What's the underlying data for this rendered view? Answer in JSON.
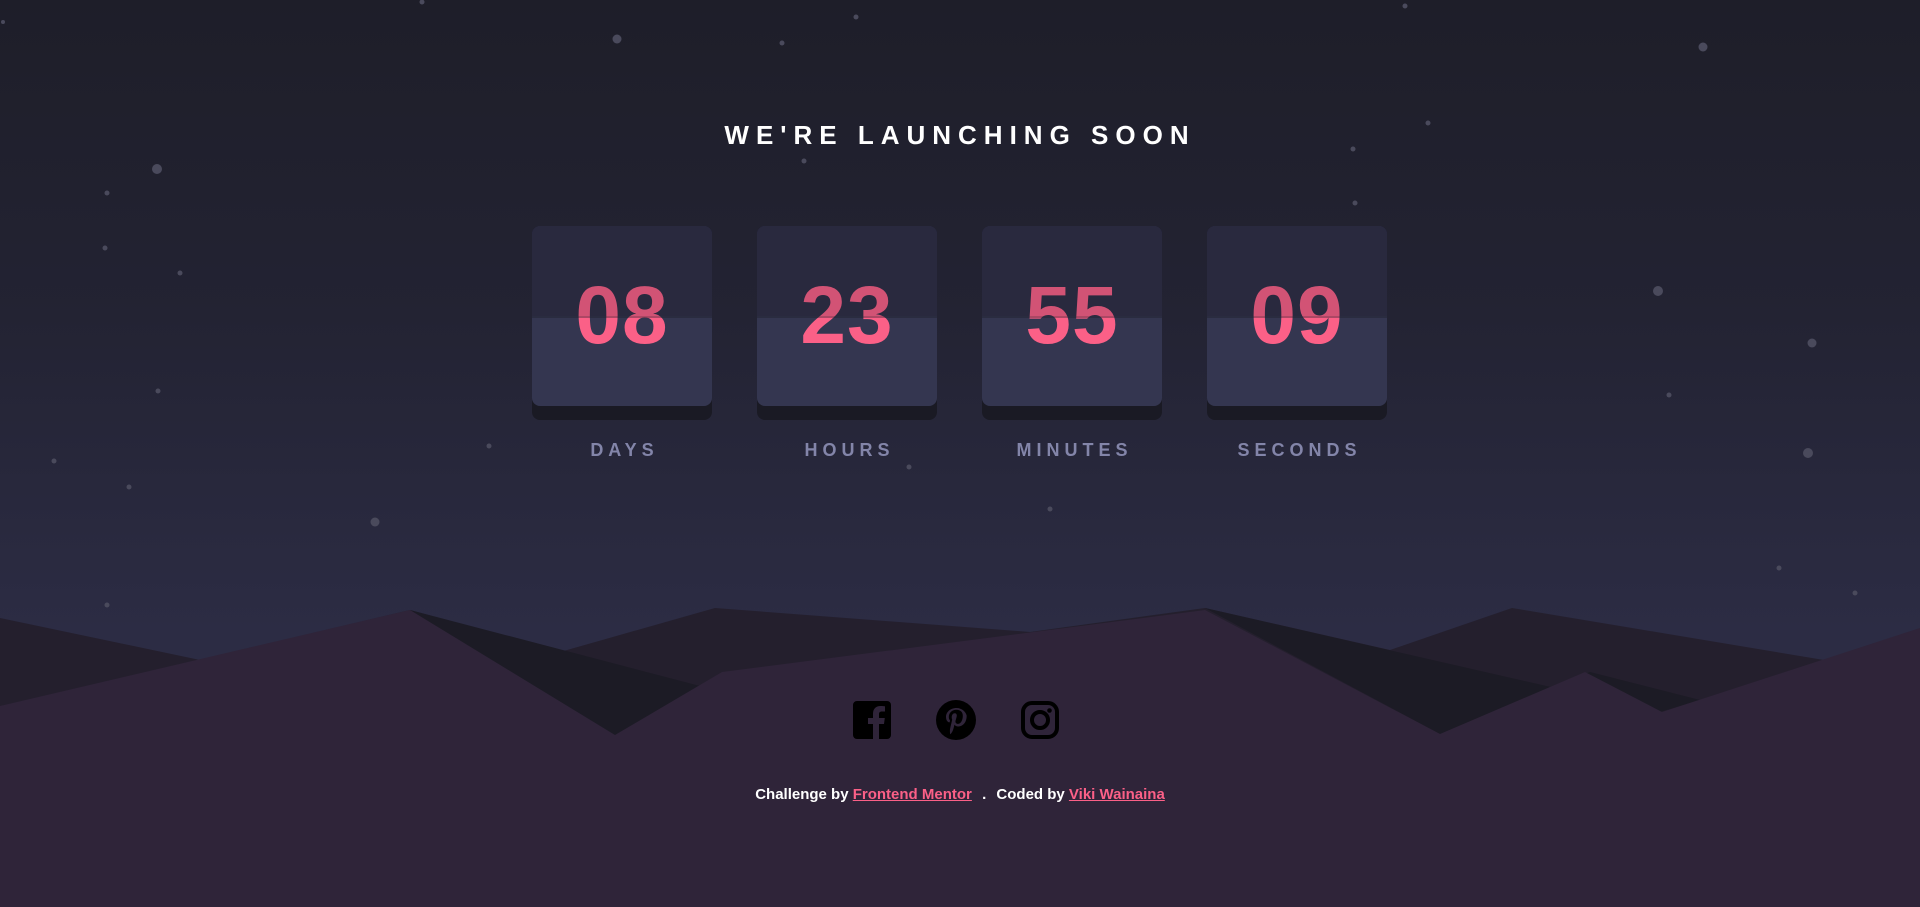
{
  "header": {
    "title": "WE'RE LAUNCHING SOON"
  },
  "countdown": [
    {
      "value": "08",
      "label": "DAYS"
    },
    {
      "value": "23",
      "label": "HOURS"
    },
    {
      "value": "55",
      "label": "MINUTES"
    },
    {
      "value": "09",
      "label": "SECONDS"
    }
  ],
  "socials": [
    {
      "icon": "facebook-icon"
    },
    {
      "icon": "pinterest-icon"
    },
    {
      "icon": "instagram-icon"
    }
  ],
  "attribution": {
    "challenge_prefix": "Challenge by",
    "challenge_link": "Frontend Mentor",
    "separator": ".",
    "coded_prefix": "Coded by",
    "coded_link": "Viki Wainaina"
  },
  "colors": {
    "accent": "#fb6087",
    "label": "#8385a9",
    "card": "#343650",
    "hills": "#2f2439"
  }
}
